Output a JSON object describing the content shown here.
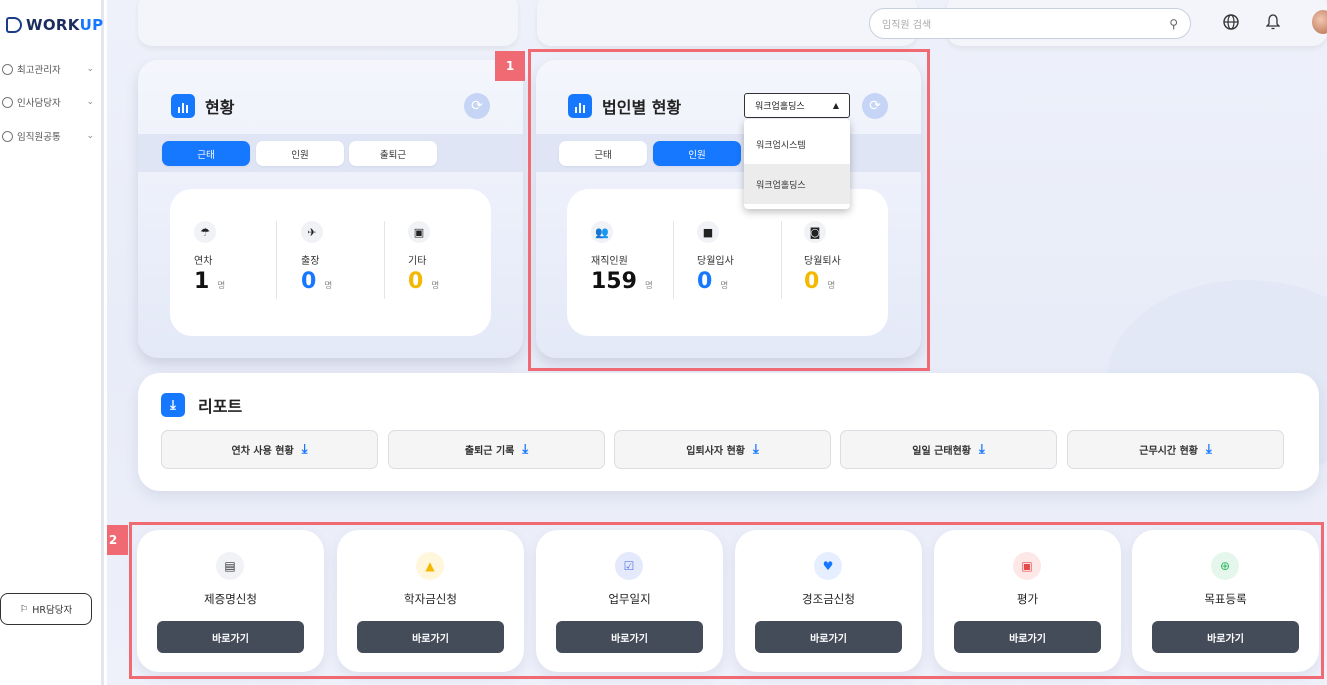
{
  "app": {
    "logo_text_a": "WORK",
    "logo_text_b": "UP"
  },
  "sidebar": {
    "items": [
      {
        "label": "최고관리자"
      },
      {
        "label": "인사담당자"
      },
      {
        "label": "임직원공통"
      }
    ],
    "hr_button_label": "HR담당자"
  },
  "header": {
    "search_placeholder": "임직원 검색",
    "icons": [
      "search-icon",
      "globe-icon",
      "bell-icon"
    ]
  },
  "status_card": {
    "title": "현황",
    "tabs": [
      {
        "label": "근태",
        "active": true
      },
      {
        "label": "인원",
        "active": false
      },
      {
        "label": "출퇴근",
        "active": false
      }
    ],
    "stats": [
      {
        "label": "연차",
        "value": "1",
        "unit": "명",
        "icon": "umbrella-icon"
      },
      {
        "label": "출장",
        "value": "0",
        "unit": "명",
        "icon": "airplane-icon"
      },
      {
        "label": "기타",
        "value": "0",
        "unit": "명",
        "icon": "calendar-icon"
      }
    ]
  },
  "corp_card": {
    "title": "법인별 현황",
    "dropdown_value": "워크업홀딩스",
    "dropdown_options": [
      {
        "label": "워크업시스템",
        "selected": false
      },
      {
        "label": "워크업홀딩스",
        "selected": true
      }
    ],
    "tabs": [
      {
        "label": "근태",
        "active": false
      },
      {
        "label": "인원",
        "active": true
      }
    ],
    "stats": [
      {
        "label": "재직인원",
        "value": "159",
        "unit": "명",
        "icon": "people-icon"
      },
      {
        "label": "당월입사",
        "value": "0",
        "unit": "명",
        "icon": "briefcase-icon"
      },
      {
        "label": "당월퇴사",
        "value": "0",
        "unit": "명",
        "icon": "briefcase-clock-icon"
      }
    ]
  },
  "report": {
    "title": "리포트",
    "buttons": [
      {
        "label": "연차 사용 현황"
      },
      {
        "label": "출퇴근 기록"
      },
      {
        "label": "입퇴사자 현황"
      },
      {
        "label": "일일 근태현황"
      },
      {
        "label": "근무시간 현황"
      }
    ]
  },
  "shortcuts": {
    "go_label": "바로가기",
    "items": [
      {
        "label": "제증명신청",
        "icon": "clipboard-icon",
        "color": "#f1f2f5",
        "fg": "#333333"
      },
      {
        "label": "학자금신청",
        "icon": "graduation-cap-icon",
        "color": "#fff6dc",
        "fg": "#f5b800"
      },
      {
        "label": "업무일지",
        "icon": "checklist-icon",
        "color": "#e4e9fb",
        "fg": "#5b7be8"
      },
      {
        "label": "경조금신청",
        "icon": "heart-icon",
        "color": "#e6efff",
        "fg": "#1677ff"
      },
      {
        "label": "평가",
        "icon": "badge-icon",
        "color": "#fde7e7",
        "fg": "#e54848"
      },
      {
        "label": "목표등록",
        "icon": "plus-circle-icon",
        "color": "#e5f7ec",
        "fg": "#2db55d"
      }
    ]
  },
  "annotations": {
    "label_1": "1",
    "label_2": "2",
    "highlight_color": "#f06a73"
  },
  "colors": {
    "accent": "#1677ff",
    "yellow": "#f5b800",
    "dark_button": "#444b59"
  }
}
